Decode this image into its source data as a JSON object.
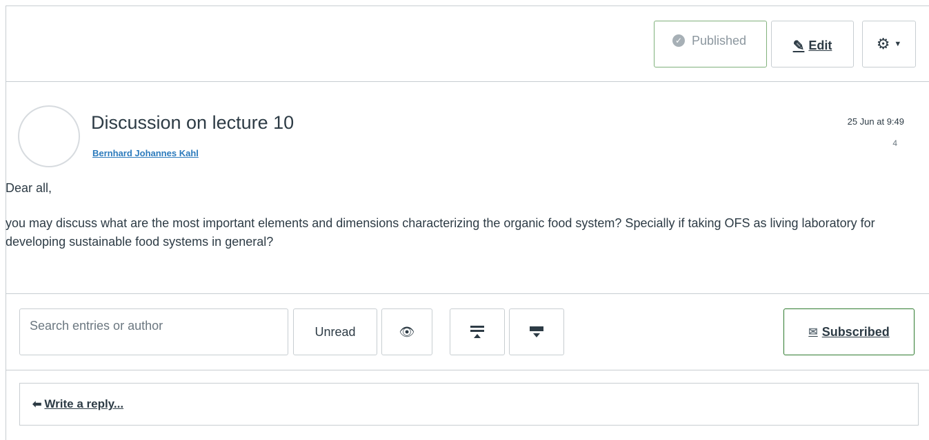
{
  "header": {
    "published_label": "Published",
    "edit_label": "Edit",
    "settings_icon": "gear-icon"
  },
  "topic": {
    "title": "Discussion on lecture 10",
    "author": "Bernhard Johannes Kahl",
    "date": "25 Jun at 9:49",
    "reply_count": "4",
    "greeting": "Dear all,",
    "body": "you may discuss what are the most important elements and dimensions characterizing the organic food system? Specially if taking OFS as living laboratory for developing sustainable food systems in general?"
  },
  "toolbar": {
    "search_placeholder": "Search entries or author",
    "unread_label": "Unread",
    "subscribed_label": "Subscribed"
  },
  "reply": {
    "label": "Write a reply..."
  },
  "colors": {
    "published_border": "#7fb07a",
    "subscribed_border": "#2e7a2e",
    "link": "#2b7abc",
    "text": "#2d3b45"
  }
}
